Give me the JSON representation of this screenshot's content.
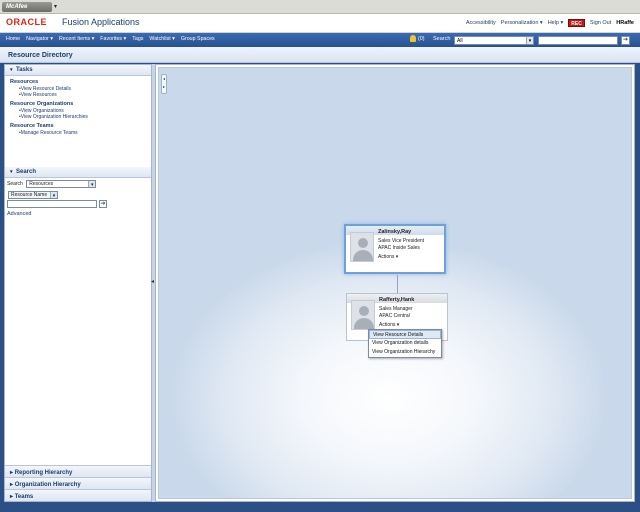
{
  "browser": {
    "mcafee_label": "McAfee"
  },
  "header": {
    "logo": "ORACLE",
    "app_title": "Fusion Applications",
    "links": {
      "accessibility": "Accessibility",
      "personalization": "Personalization ▾",
      "help": "Help ▾",
      "rec": "REC",
      "sign_out": "Sign Out",
      "user": "HRaffe"
    }
  },
  "nav": {
    "items": [
      "Home",
      "Navigator ▾",
      "Recent Items ▾",
      "Favorites ▾",
      "Tags",
      "Watchlist ▾",
      "Group Spaces"
    ],
    "watch_count": "(0)",
    "search_label": "Search",
    "search_scope": "All"
  },
  "page_title": "Resource Directory",
  "tasks": {
    "title": "Tasks",
    "groups": [
      {
        "heading": "Resources",
        "links": [
          "View Resource Details",
          "View Resources"
        ]
      },
      {
        "heading": "Resource Organizations",
        "links": [
          "View Organizations",
          "View Organization Hierarchies"
        ]
      },
      {
        "heading": "Resource Teams",
        "links": [
          "Manage Resource Teams"
        ]
      }
    ]
  },
  "search_panel": {
    "title": "Search",
    "search_label": "Search",
    "search_type": "Resources",
    "field_selector": "Resource Name",
    "advanced": "Advanced"
  },
  "bottom_panels": [
    "Reporting Hierarchy",
    "Organization Hierarchy",
    "Teams"
  ],
  "hierarchy": {
    "manager": {
      "name": "Zalinsky,Ray",
      "title": "Sales Vice President",
      "org": "APAC Inside Sales",
      "actions": "Actions ▾"
    },
    "employee": {
      "name": "Rafferty,Hank",
      "title": "Sales Manager",
      "org": "APAC Central",
      "actions": "Actions ▾"
    },
    "menu": [
      "View Resource Details",
      "View Organization details",
      "View Organization Hierarchy"
    ]
  },
  "colors": {
    "brand_red": "#e22410",
    "nav_blue": "#2d5ca0",
    "link_blue": "#1d3d6d",
    "selected_border": "#6fa0d8"
  }
}
